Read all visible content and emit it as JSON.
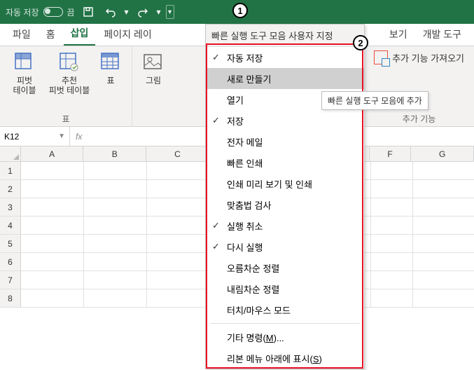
{
  "titlebar": {
    "autosave_label": "자동 저장",
    "autosave_state": "끔"
  },
  "badges": {
    "one": "1",
    "two": "2"
  },
  "tabs": {
    "file": "파일",
    "home": "홈",
    "insert": "삽입",
    "pagelayout": "페이지 레이",
    "view": "보기",
    "developer": "개발 도구"
  },
  "ribbon": {
    "pivot": "피벗\n테이블",
    "pivot_rec": "추천\n피벗 테이블",
    "table_item": "표",
    "picture": "그림",
    "group_table": "표",
    "addins_get": "추가 기능 가져오기",
    "group_addins": "추가 기능"
  },
  "formula": {
    "namebox": "K12",
    "fx": "fx"
  },
  "columns": [
    "A",
    "B",
    "C",
    "",
    "F",
    "G"
  ],
  "rows": [
    "1",
    "2",
    "3",
    "4",
    "5",
    "6",
    "7",
    "8"
  ],
  "qat_menu": {
    "header": "빠른 실행 도구 모음 사용자 지정",
    "items": [
      {
        "label": "자동 저장",
        "checked": true
      },
      {
        "label": "새로 만들기",
        "checked": false,
        "hover": true
      },
      {
        "label": "열기",
        "checked": false
      },
      {
        "label": "저장",
        "checked": true
      },
      {
        "label": "전자 메일",
        "checked": false
      },
      {
        "label": "빠른 인쇄",
        "checked": false
      },
      {
        "label": "인쇄 미리 보기 및 인쇄",
        "checked": false
      },
      {
        "label": "맞춤법 검사",
        "checked": false
      },
      {
        "label": "실행 취소",
        "checked": true
      },
      {
        "label": "다시 실행",
        "checked": true
      },
      {
        "label": "오름차순 정렬",
        "checked": false
      },
      {
        "label": "내림차순 정렬",
        "checked": false
      },
      {
        "label": "터치/마우스 모드",
        "checked": false
      }
    ],
    "more_prefix": "기타 명령(",
    "more_key": "M",
    "more_suffix": ")...",
    "below_prefix": "리본 메뉴 아래에 표시(",
    "below_key": "S",
    "below_suffix": ")"
  },
  "tooltip": "빠른 실행 도구 모음에 추가"
}
